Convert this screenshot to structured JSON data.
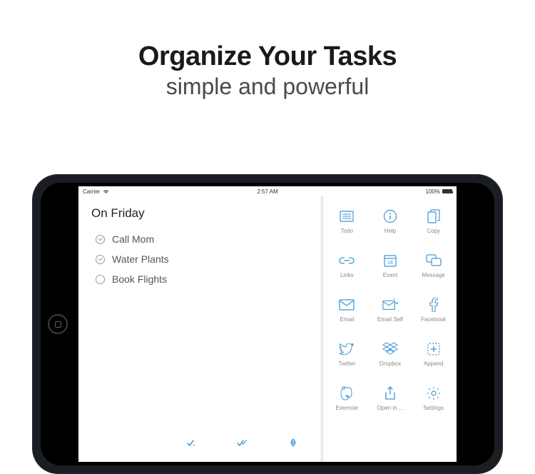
{
  "headline": {
    "title": "Organize Your Tasks",
    "subtitle": "simple and powerful"
  },
  "status": {
    "carrier": "Carrier",
    "time": "2:57 AM",
    "battery": "100%"
  },
  "list": {
    "title": "On Friday",
    "tasks": [
      {
        "label": "Call Mom",
        "done": true
      },
      {
        "label": "Water Plants",
        "done": true
      },
      {
        "label": "Book Flights",
        "done": false
      }
    ]
  },
  "actions": [
    {
      "id": "todo",
      "label": "Todo"
    },
    {
      "id": "help",
      "label": "Help"
    },
    {
      "id": "copy",
      "label": "Copy"
    },
    {
      "id": "links",
      "label": "Links"
    },
    {
      "id": "event",
      "label": "Event"
    },
    {
      "id": "message",
      "label": "Message"
    },
    {
      "id": "email",
      "label": "Email"
    },
    {
      "id": "email-self",
      "label": "Email Self"
    },
    {
      "id": "facebook",
      "label": "Facebook"
    },
    {
      "id": "twitter",
      "label": "Twitter"
    },
    {
      "id": "dropbox",
      "label": "Dropbox"
    },
    {
      "id": "append",
      "label": "Append"
    },
    {
      "id": "evernote",
      "label": "Evernote"
    },
    {
      "id": "open-in",
      "label": "Open in ..."
    },
    {
      "id": "settings",
      "label": "Settings"
    }
  ],
  "colors": {
    "accent": "#3b97d3",
    "text_muted": "#8a8a8a"
  }
}
